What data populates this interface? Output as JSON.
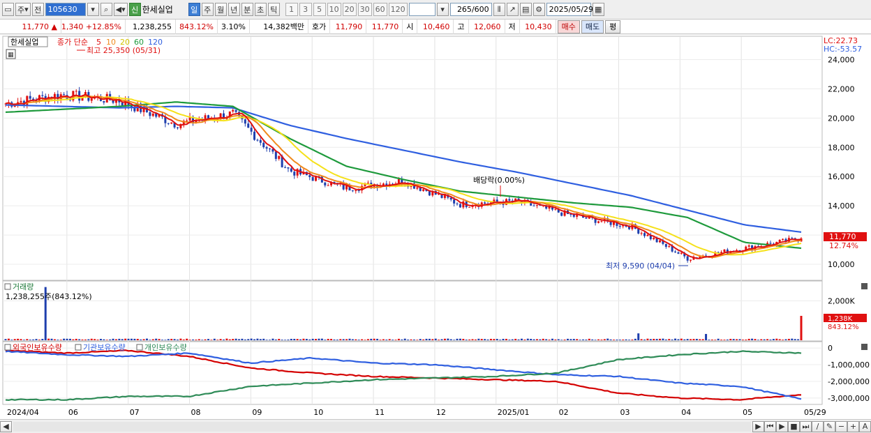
{
  "toolbar": {
    "market_label": "주",
    "prev_label": "전",
    "stock_code": "105630",
    "new_badge": "신",
    "stock_name": "한세실업",
    "period_tabs": [
      "일",
      "주",
      "월",
      "년",
      "분",
      "초",
      "틱"
    ],
    "minute_options": [
      "1",
      "3",
      "5",
      "10",
      "20",
      "30",
      "60",
      "120"
    ],
    "count": "265",
    "count_total": "/600",
    "date": "2025/05/29"
  },
  "quote": {
    "price": "11,770",
    "change": "1,340",
    "change_pct": "+12.85%",
    "volume": "1,238,255",
    "volume_ratio": "843.12%",
    "turnover_pct": "3.10%",
    "trade_value": "14,382백만",
    "ask_label": "호가",
    "ask": "11,790",
    "bid": "11,770",
    "open_label": "시",
    "open": "10,460",
    "high_label": "고",
    "high": "12,060",
    "low_label": "저",
    "low": "10,430",
    "buy_label": "매수",
    "sell_label": "매도",
    "flat_label": "평"
  },
  "legend": {
    "name": "한세실업",
    "ma_title": "종가 단순",
    "ma_periods": [
      "5",
      "10",
      "20",
      "60",
      "120"
    ],
    "lc": "LC:22.73",
    "hc": "HC:-53.57",
    "high_note": "최고 25,350 (05/31)",
    "low_note": "최저 9,590 (04/04)",
    "dividend_note": "배당락(0.00%)",
    "price_tag": "11,770",
    "price_pct": "12.74%"
  },
  "volume_panel": {
    "title": "거래량",
    "value": "1,238,255주(843.12%)",
    "tag": "1,238K",
    "tag_pct": "843.12%"
  },
  "holdings_panel": {
    "series": [
      "외국인보유수량",
      "기관보유수량",
      "개인보유수량"
    ]
  },
  "colors": {
    "ma5": "#e01010",
    "ma10": "#f08a1c",
    "ma20": "#f5e11a",
    "ma60": "#1e9a3c",
    "ma120": "#2f5fe0",
    "up": "#e01010",
    "down": "#1f3fae",
    "foreign": "#d40000",
    "institution": "#2f5fe0",
    "individual": "#2e8b57"
  },
  "chart_data": [
    {
      "type": "line",
      "panel": "price",
      "x": [
        "2024/04",
        "2024/05",
        "2024/06",
        "2024/07",
        "2024/08",
        "2024/09",
        "2024/10",
        "2024/11",
        "2024/12",
        "2025/01",
        "2025/02",
        "2025/03",
        "2025/04",
        "2025/05",
        "2025/05/29"
      ],
      "series": [
        {
          "name": "종가",
          "values": [
            21000,
            21600,
            21200,
            19600,
            20300,
            16400,
            15200,
            15700,
            14100,
            14300,
            13300,
            12600,
            10400,
            11100,
            11770
          ]
        },
        {
          "name": "120",
          "values": [
            20900,
            20800,
            20700,
            20800,
            20700,
            19500,
            18600,
            17800,
            17000,
            16300,
            15500,
            14700,
            13700,
            12700,
            12200
          ]
        },
        {
          "name": "60",
          "values": [
            20400,
            20600,
            20800,
            21100,
            20800,
            18600,
            16700,
            15800,
            15000,
            14600,
            14200,
            13900,
            13200,
            11500,
            11100
          ]
        }
      ],
      "ylim": [
        9000,
        25500
      ],
      "yticks": [
        "10,000",
        "12,000",
        "14,000",
        "16,000",
        "18,000",
        "20,000",
        "22,000",
        "24,000"
      ],
      "xticks": [
        "2024/04",
        "06",
        "07",
        "08",
        "09",
        "10",
        "11",
        "12",
        "2025/01",
        "02",
        "03",
        "04",
        "05",
        "05/29"
      ]
    },
    {
      "type": "bar",
      "panel": "volume",
      "ylim": [
        0,
        2900000
      ],
      "yticks": [
        "2,000K"
      ],
      "spikes": [
        {
          "x": "2024/05/31",
          "value": 2700000
        },
        {
          "x": "2025/02/28",
          "value": 350000
        },
        {
          "x": "2025/04/03",
          "value": 320000
        },
        {
          "x": "2025/05/29",
          "value": 1238255
        }
      ]
    },
    {
      "type": "line",
      "panel": "holdings",
      "x": [
        "2024/04",
        "2024/06",
        "2024/07",
        "2024/08",
        "2024/09",
        "2024/10",
        "2024/11",
        "2024/12",
        "2025/01",
        "2025/02",
        "2025/03",
        "2025/04",
        "2025/05",
        "2025/05/29"
      ],
      "series": [
        {
          "name": "외국인보유수량",
          "values": [
            -150000,
            -300000,
            -150000,
            -500000,
            -1200000,
            -1500000,
            -1700000,
            -1800000,
            -1900000,
            -2000000,
            -2700000,
            -3000000,
            -3100000,
            -2800000
          ]
        },
        {
          "name": "기관보유수량",
          "values": [
            -200000,
            -400000,
            -500000,
            -300000,
            -900000,
            -600000,
            -900000,
            -1000000,
            -1300000,
            -1600000,
            -1700000,
            -2100000,
            -2300000,
            -3050000
          ]
        },
        {
          "name": "개인보유수량",
          "values": [
            -3100000,
            -3100000,
            -2900000,
            -2900000,
            -2300000,
            -2100000,
            -1900000,
            -1800000,
            -1700000,
            -1500000,
            -700000,
            -400000,
            -200000,
            -300000
          ]
        }
      ],
      "ylim": [
        -3300000,
        300000
      ],
      "yticks": [
        "0",
        "-1,000,000",
        "-2,000,000",
        "-3,000,000"
      ]
    }
  ]
}
